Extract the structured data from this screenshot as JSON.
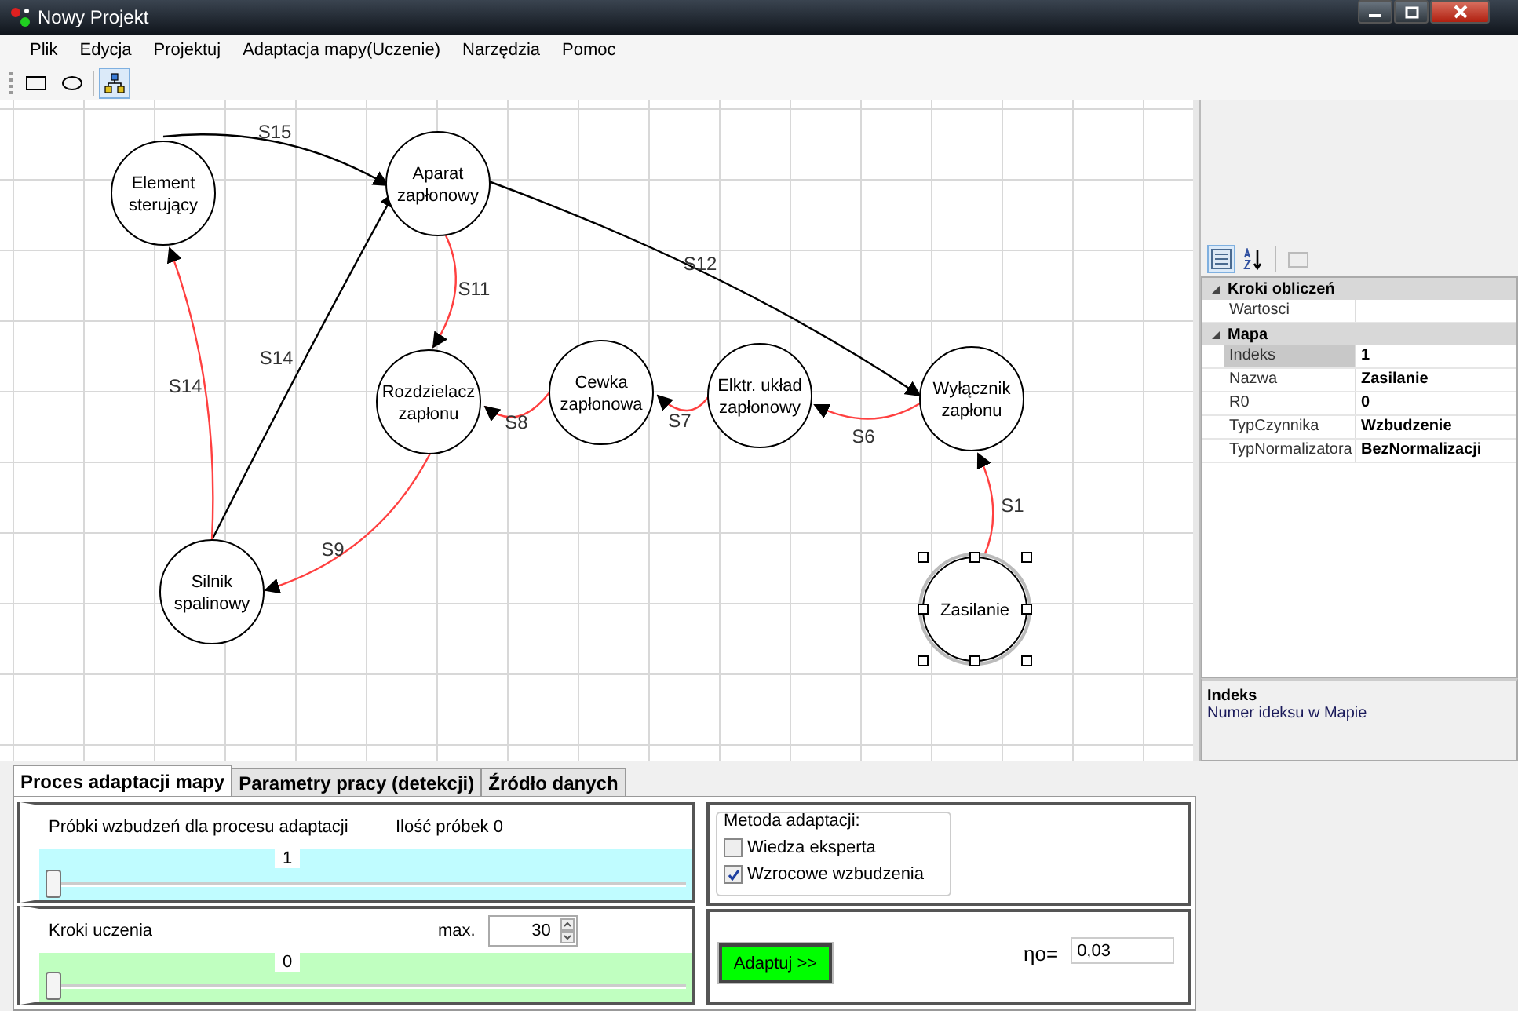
{
  "window": {
    "title": "Nowy Projekt"
  },
  "menu": [
    "Plik",
    "Edycja",
    "Projektuj",
    "Adaptacja mapy(Uczenie)",
    "Narzędzia",
    "Pomoc"
  ],
  "toolbar": [
    {
      "kind": "rect",
      "selected": false
    },
    {
      "kind": "ellipse",
      "selected": false
    },
    {
      "kind": "graph",
      "selected": true
    }
  ],
  "map": {
    "nodes": [
      {
        "lines": [
          "Element",
          "sterujący"
        ],
        "selected": false
      },
      {
        "lines": [
          "Aparat",
          "zapłonowy"
        ],
        "selected": false
      },
      {
        "lines": [
          "Rozdzielacz",
          "zapłonu"
        ],
        "selected": false
      },
      {
        "lines": [
          "Cewka",
          "zapłonowa"
        ],
        "selected": false
      },
      {
        "lines": [
          "Elktr. układ",
          "zapłonowy"
        ],
        "selected": false
      },
      {
        "lines": [
          "Wyłącznik",
          "zapłonu"
        ],
        "selected": false
      },
      {
        "lines": [
          "Silnik",
          "spalinowy"
        ],
        "selected": false
      },
      {
        "lines": [
          "Zasilanie"
        ],
        "selected": true
      }
    ],
    "edges": [
      {
        "label": "S15",
        "color": "#000000"
      },
      {
        "label": "S12",
        "color": "#000000"
      },
      {
        "label": "S11",
        "color": "#ff4040"
      },
      {
        "label": "S14",
        "color": "#000000"
      },
      {
        "label": "S14",
        "color": "#ff4040"
      },
      {
        "label": "S8",
        "color": "#ff4040"
      },
      {
        "label": "S7",
        "color": "#ff4040"
      },
      {
        "label": "S6",
        "color": "#ff4040"
      },
      {
        "label": "S9",
        "color": "#ff4040"
      },
      {
        "label": "S1",
        "color": "#ff4040"
      }
    ]
  },
  "properties": {
    "categories": [
      {
        "name": "Kroki obliczeń",
        "expanded": true,
        "rows": [
          {
            "name": "Wartosci",
            "selected": false
          }
        ]
      },
      {
        "name": "Mapa",
        "expanded": true,
        "rows": [
          {
            "name": "Indeks",
            "value": "1",
            "selected": true
          },
          {
            "name": "Nazwa",
            "value": "Zasilanie",
            "selected": false
          },
          {
            "name": "R0",
            "value": "0",
            "selected": false
          },
          {
            "name": "TypCzynnika",
            "value": "Wzbudzenie",
            "selected": false
          },
          {
            "name": "TypNormalizatora",
            "value": "BezNormalizacji",
            "selected": false
          }
        ]
      }
    ],
    "description": {
      "title": "Indeks",
      "text": "Numer ideksu w Mapie"
    }
  },
  "tabs": [
    {
      "label": "Proces adaptacji mapy",
      "selected": true
    },
    {
      "label": "Parametry pracy (detekcji)",
      "selected": false
    },
    {
      "label": "Źródło  danych",
      "selected": false
    }
  ],
  "samples": {
    "label": "Próbki wzbudzeń dla procesu adaptacji",
    "count": "Ilość próbek 0",
    "value": "1",
    "level": 0
  },
  "steps": {
    "label": "Kroki uczenia",
    "max_label": "max.",
    "max": "30",
    "value": "0",
    "level": 0
  },
  "method": {
    "title": "Metoda adaptacji:",
    "options": [
      {
        "label": "Wiedza eksperta",
        "checked": false
      },
      {
        "label": "Wzrocowe wzbudzenia",
        "checked": true
      }
    ]
  },
  "adapt_button": "Adaptuj >>",
  "eta": {
    "label": "ηo=",
    "value": "0,03"
  }
}
